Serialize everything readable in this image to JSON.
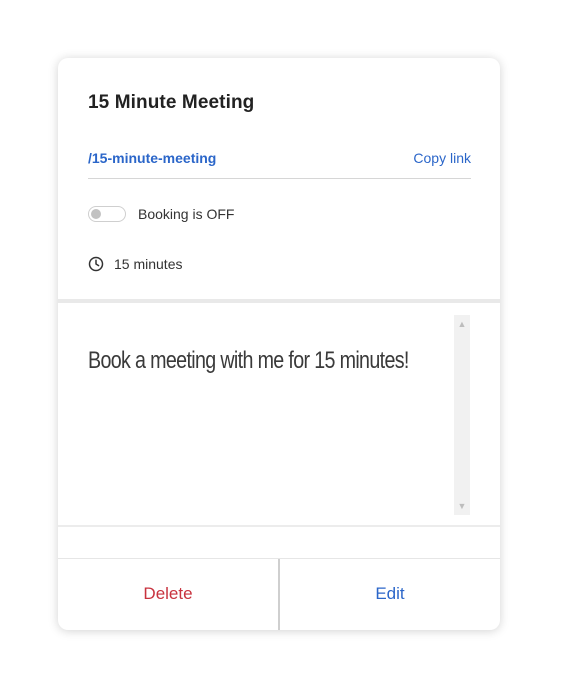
{
  "card": {
    "title": "15 Minute Meeting",
    "slug": "/15-minute-meeting",
    "copy_link_label": "Copy link",
    "booking_toggle": {
      "state": "off",
      "label": "Booking is OFF"
    },
    "duration": {
      "icon": "clock-icon",
      "label": "15 minutes"
    },
    "description": "Book a meeting with me for 15 minutes!",
    "actions": {
      "delete_label": "Delete",
      "edit_label": "Edit"
    }
  },
  "colors": {
    "link": "#2b66c9",
    "delete": "#c8323e",
    "text": "#222222"
  }
}
